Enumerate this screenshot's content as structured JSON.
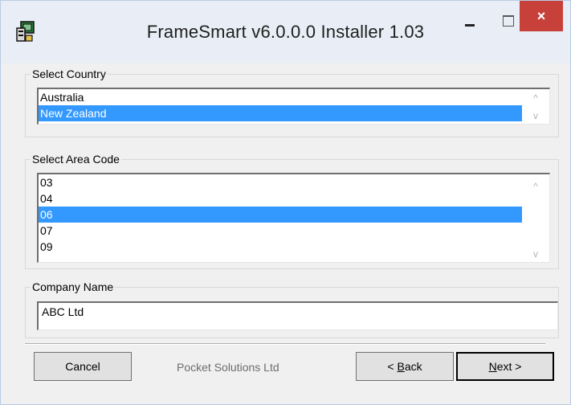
{
  "window": {
    "title": "FrameSmart v6.0.0.0 Installer 1.03",
    "app_icon": "installer-app-icon",
    "controls": {
      "minimize": "minimize-icon",
      "maximize": "maximize-icon",
      "close": "×"
    }
  },
  "country": {
    "label": "Select Country",
    "items": [
      "Australia",
      "New Zealand"
    ],
    "selected": "New Zealand"
  },
  "area_code": {
    "label": "Select Area Code",
    "items": [
      "03",
      "04",
      "06",
      "07",
      "09"
    ],
    "selected": "06"
  },
  "company": {
    "label": "Company Name",
    "value": "ABC Ltd"
  },
  "footer": {
    "cancel_label": "Cancel",
    "brand_text": "Pocket Solutions Ltd",
    "back_prefix": "< ",
    "back_underlined": "B",
    "back_rest": "ack",
    "next_underlined": "N",
    "next_rest": "ext >"
  },
  "colors": {
    "selection": "#3399ff",
    "close_button": "#c7403a",
    "title_bar": "#e9eef6"
  }
}
